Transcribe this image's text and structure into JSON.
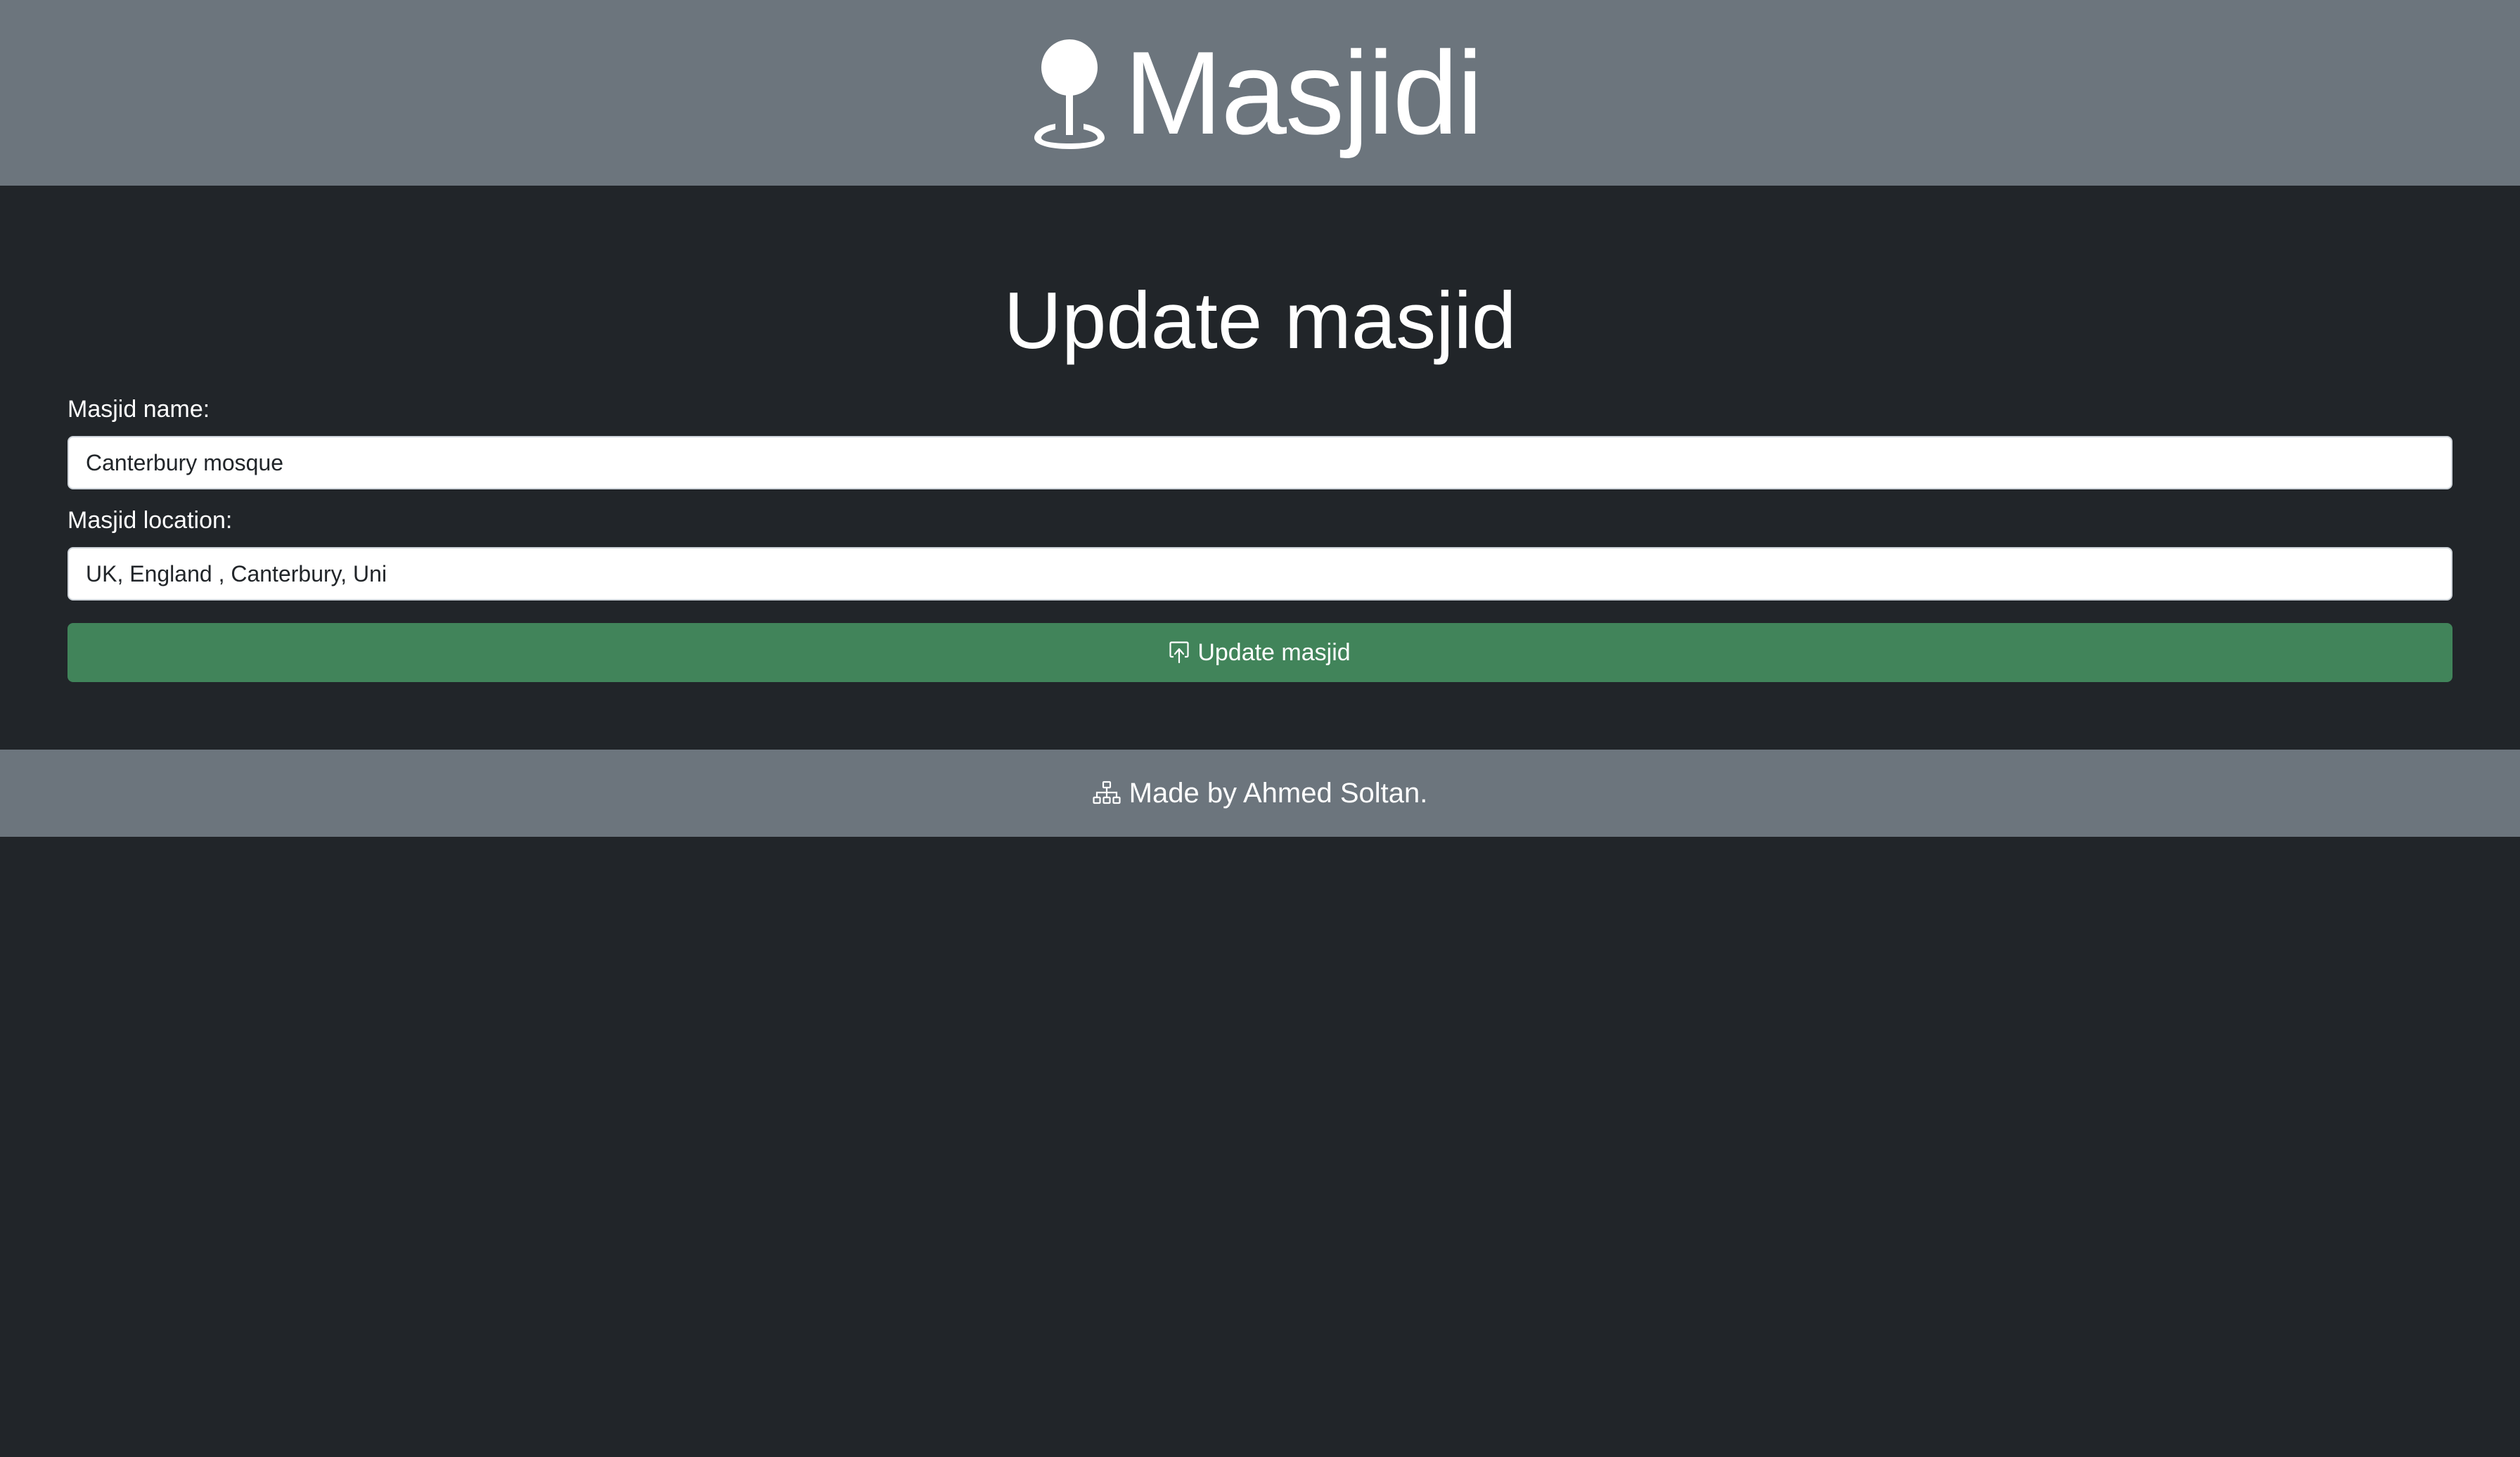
{
  "header": {
    "brand_name": "Masjidi",
    "brand_icon": "map-pin-icon"
  },
  "main": {
    "title": "Update masjid",
    "form": {
      "name_label": "Masjid name:",
      "name_value": "Canterbury mosque",
      "location_label": "Masjid location:",
      "location_value": "UK, England , Canterbury, Uni",
      "submit_label": "Update masjid",
      "submit_icon": "upload-icon"
    }
  },
  "footer": {
    "text": "Made by Ahmed Soltan.",
    "icon": "sitemap-icon"
  },
  "colors": {
    "header_bg": "#6c757d",
    "page_bg": "#212529",
    "button_bg": "#41845a",
    "footer_bg": "#6c757d"
  }
}
